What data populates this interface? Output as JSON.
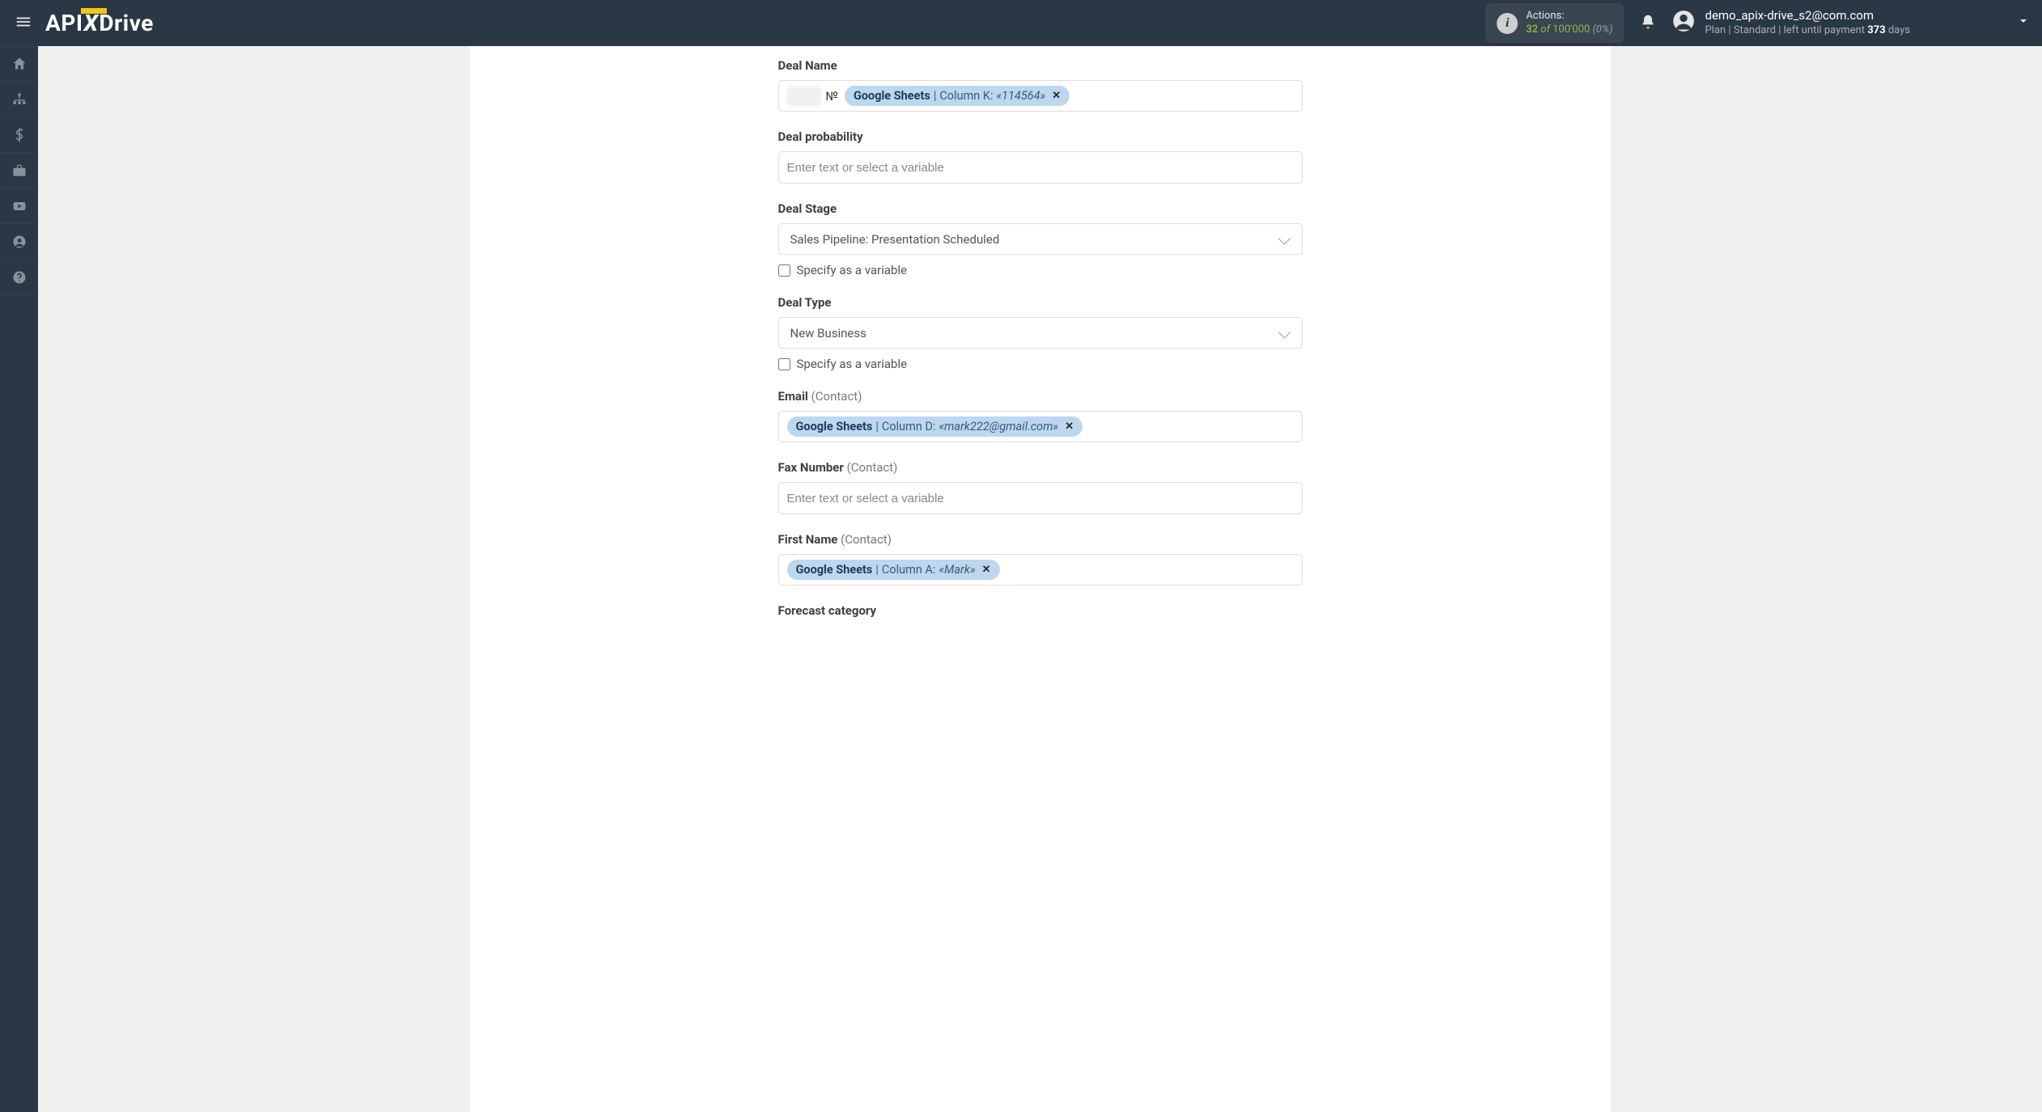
{
  "topbar": {
    "actions": {
      "label": "Actions:",
      "count": "32",
      "of": "of",
      "max": "100'000",
      "pct": "(0%)"
    },
    "user": {
      "email": "demo_apix-drive_s2@com.com",
      "plan_prefix": "Plan |",
      "plan_name": "Standard",
      "plan_suffix": "| left until payment",
      "days_num": "373",
      "days_label": "days"
    }
  },
  "form": {
    "placeholder": "Enter text or select a variable",
    "specify_var": "Specify as a variable",
    "fields": {
      "deal_name": {
        "label": "Deal Name",
        "prefix": "№",
        "chip": {
          "source": "Google Sheets",
          "col": "Column K:",
          "val": "«114564»"
        }
      },
      "deal_probability": {
        "label": "Deal probability"
      },
      "deal_stage": {
        "label": "Deal Stage",
        "value": "Sales Pipeline: Presentation Scheduled"
      },
      "deal_type": {
        "label": "Deal Type",
        "value": "New Business"
      },
      "email": {
        "label": "Email",
        "suffix": "(Contact)",
        "chip": {
          "source": "Google Sheets",
          "col": "Column D:",
          "val": "«mark222@gmail.com»"
        }
      },
      "fax": {
        "label": "Fax Number",
        "suffix": "(Contact)"
      },
      "first_name": {
        "label": "First Name",
        "suffix": "(Contact)",
        "chip": {
          "source": "Google Sheets",
          "col": "Column A:",
          "val": "«Mark»"
        }
      },
      "forecast": {
        "label": "Forecast category"
      }
    }
  }
}
